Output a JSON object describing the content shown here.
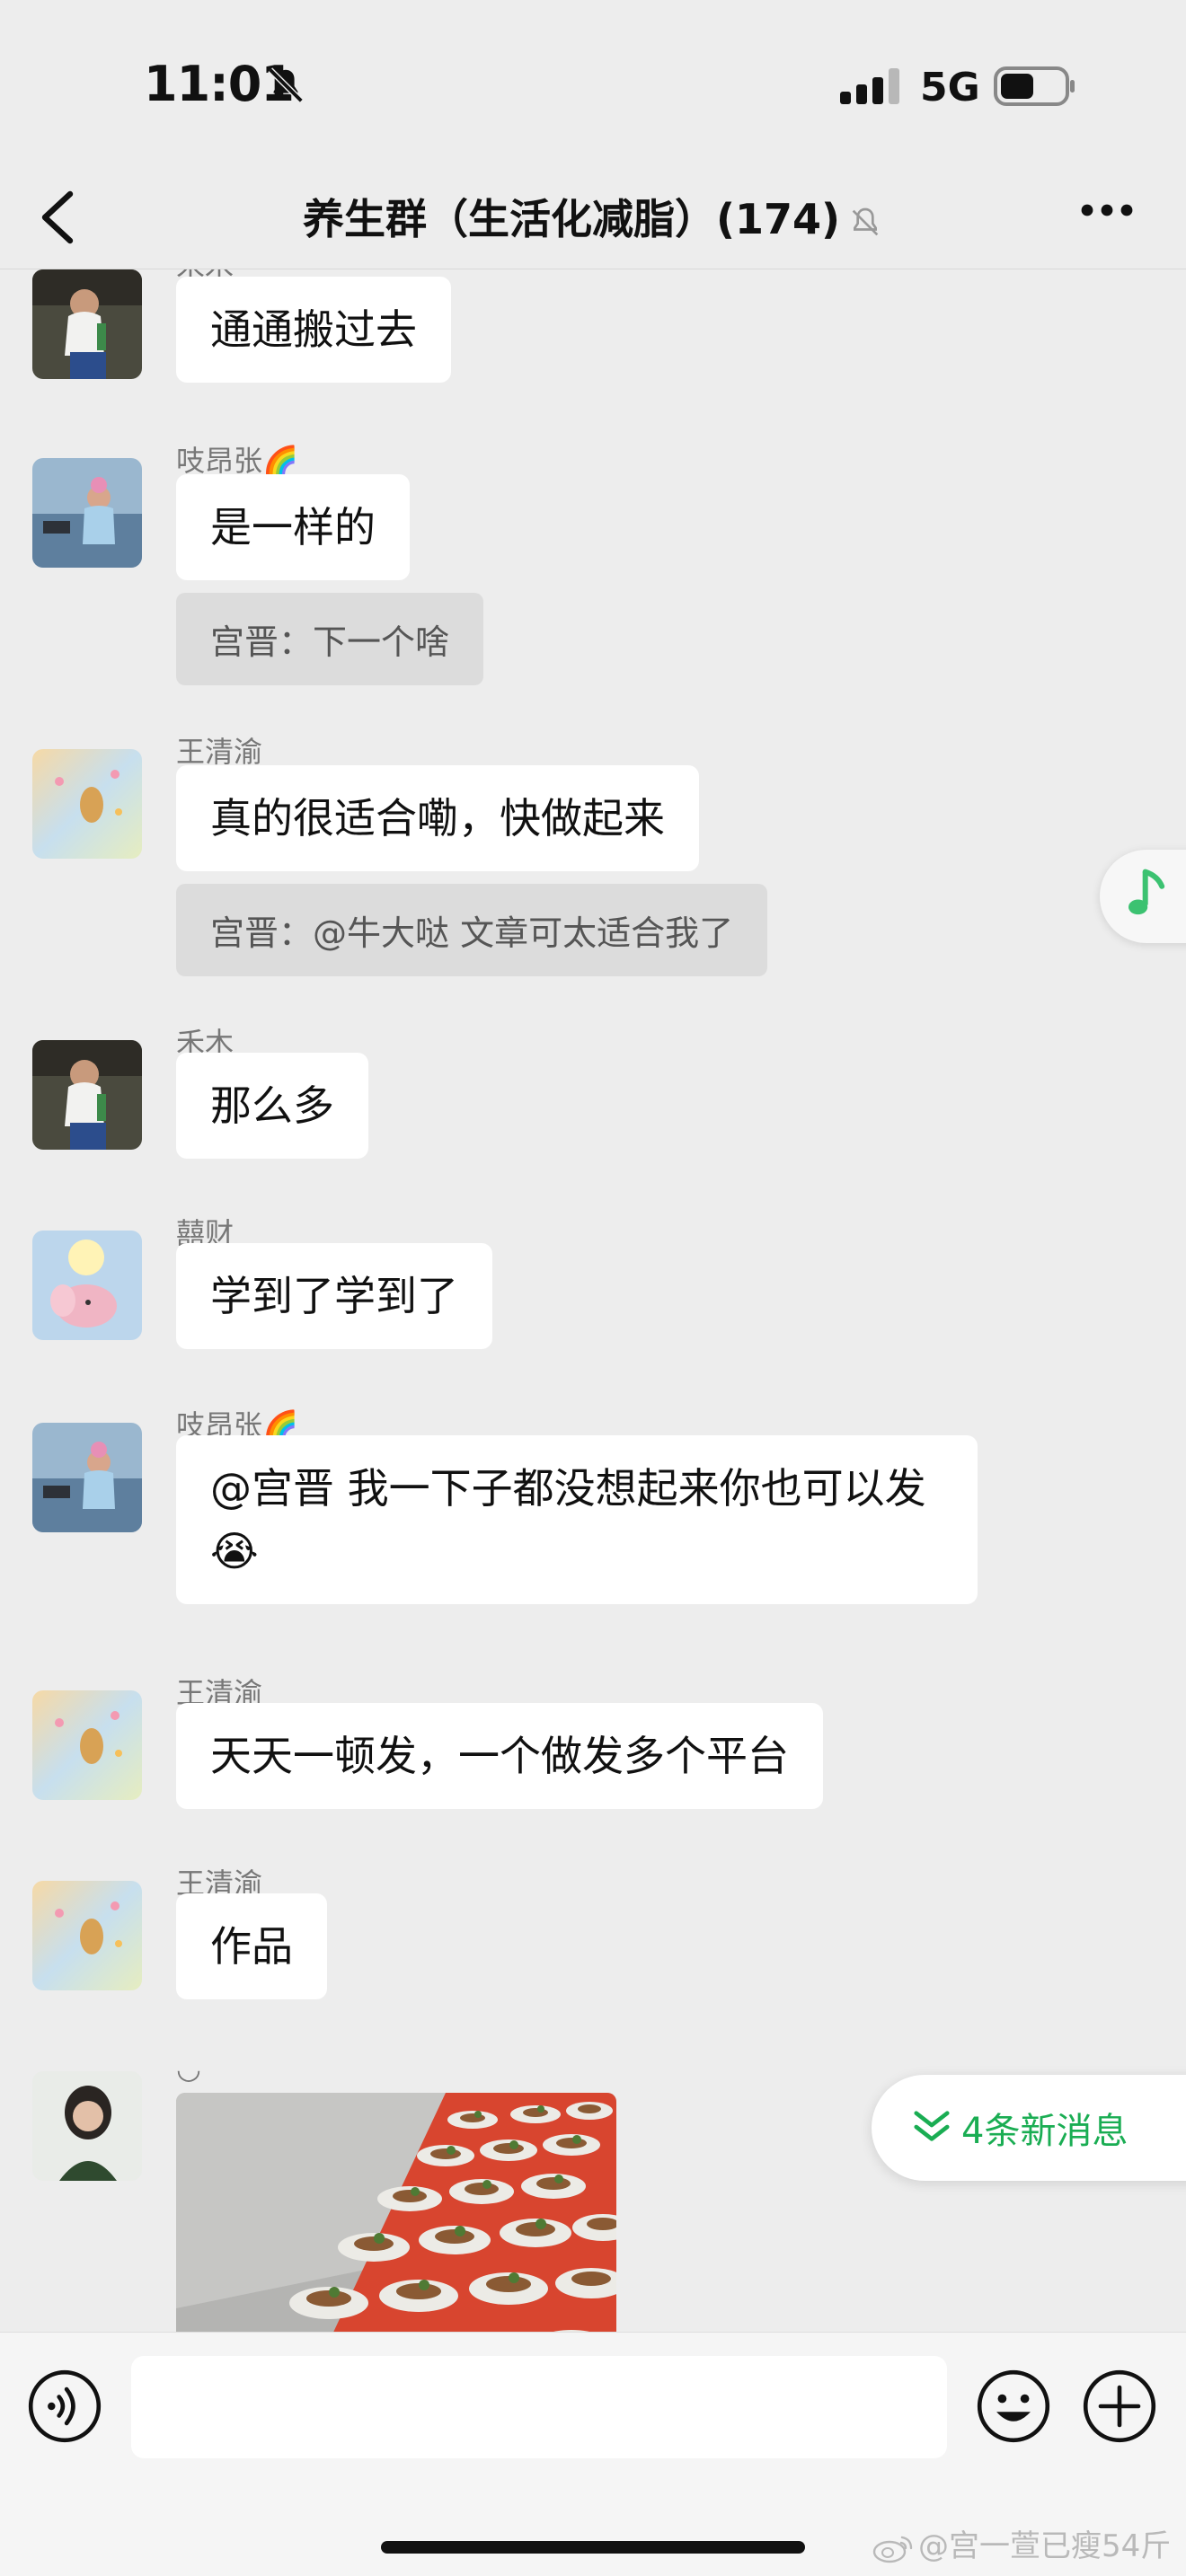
{
  "status_bar": {
    "time": "11:01",
    "network": "5G",
    "icons": [
      "bell-slash-icon",
      "cellular-signal-icon",
      "battery-icon"
    ]
  },
  "nav": {
    "title": "养生群（生活化减脂）(174)",
    "icons": [
      "back-chevron-icon",
      "muted-bell-icon",
      "more-dots-icon"
    ]
  },
  "messages": [
    {
      "sender": "禾木",
      "text": "通通搬过去"
    },
    {
      "sender": "吱昂张🌈",
      "text": "是一样的",
      "quote": "宫晋：下一个啥"
    },
    {
      "sender": "王清渝",
      "text": "真的很适合嘞，快做起来",
      "quote": "宫晋：@牛大哒 文章可太适合我了"
    },
    {
      "sender": "禾木",
      "text": "那么多"
    },
    {
      "sender": "囍财",
      "text": "学到了学到了"
    },
    {
      "sender": "吱昂张🌈",
      "text": "@宫晋 我一下子都没想起来你也可以发😭"
    },
    {
      "sender": "王清渝",
      "text": "天天一顿发，一个做发多个平台"
    },
    {
      "sender": "王清渝",
      "text": "作品"
    },
    {
      "sender": "◡",
      "image": "food-platters-photo"
    }
  ],
  "new_messages_button": {
    "label": "4条新消息",
    "icon": "double-chevron-down-icon"
  },
  "floating_music": {
    "icon": "music-note-icon"
  },
  "input_bar": {
    "placeholder": "",
    "icons": [
      "voice-icon",
      "emoji-icon",
      "plus-icon"
    ]
  },
  "watermark": "@宫一萱已瘦54斤",
  "colors": {
    "background": "#ededed",
    "bubble": "#ffffff",
    "quote": "#dcdcdc",
    "accent_green": "#1aad53"
  }
}
